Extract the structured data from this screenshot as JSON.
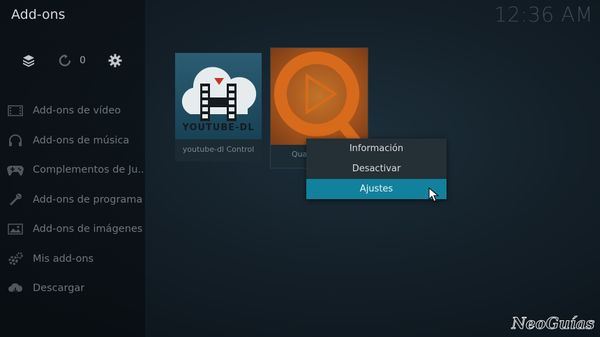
{
  "header": {
    "title": "Add-ons",
    "clock": "12:36 AM"
  },
  "toolbar": {
    "update_count": "0"
  },
  "sidebar": {
    "items": [
      {
        "label": "Add-ons de vídeo",
        "icon": "film-icon"
      },
      {
        "label": "Add-ons de música",
        "icon": "headphones-icon"
      },
      {
        "label": "Complementos de Ju...",
        "icon": "gamepad-icon"
      },
      {
        "label": "Add-ons de programas",
        "icon": "tools-icon"
      },
      {
        "label": "Add-ons de imágenes",
        "icon": "picture-icon"
      },
      {
        "label": "Mis add-ons",
        "icon": "gears-icon"
      },
      {
        "label": "Descargar",
        "icon": "cloud-download-icon"
      }
    ]
  },
  "tiles": [
    {
      "label": "youtube-dl Control",
      "art_text": "YOUTUBE-DL"
    },
    {
      "label": "Qua"
    }
  ],
  "context_menu": {
    "items": [
      "Información",
      "Desactivar",
      "Ajustes"
    ],
    "selected": "Ajustes"
  },
  "watermark": "NeoGuías",
  "colors": {
    "accent": "#12819d"
  }
}
